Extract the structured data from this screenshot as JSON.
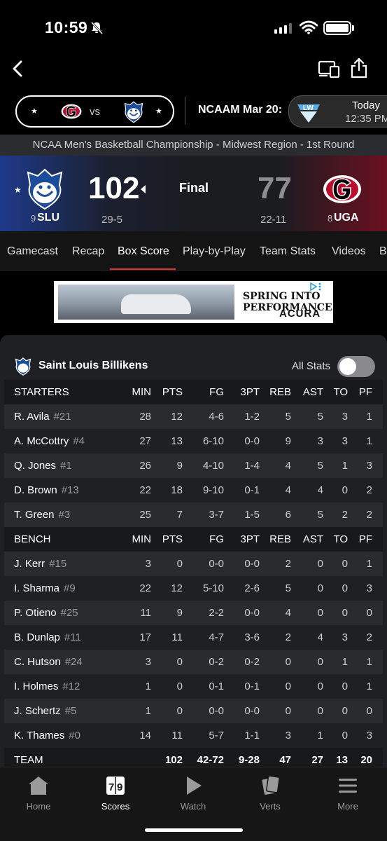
{
  "status_bar": {
    "time": "10:59"
  },
  "matchup": {
    "vs_label": "vs",
    "next_game_label": "NCAAM Mar 20:",
    "next_game_day": "Today",
    "next_game_time": "12:35 PM"
  },
  "tournament_label": "NCAA Men's Basketball Championship - Midwest Region - 1st Round",
  "score": {
    "home": {
      "seed": "9",
      "abbr": "SLU",
      "score": "102",
      "record": "29-5"
    },
    "away": {
      "seed": "8",
      "abbr": "UGA",
      "score": "77",
      "record": "22-11"
    },
    "status": "Final"
  },
  "tabs": [
    "Gamecast",
    "Recap",
    "Box Score",
    "Play-by-Play",
    "Team Stats",
    "Videos",
    "B"
  ],
  "active_tab": "Box Score",
  "ad": {
    "headline": "SPRING INTO PERFORMANCE.",
    "brand": "ACURA"
  },
  "box": {
    "team_name": "Saint Louis Billikens",
    "all_stats_label": "All Stats",
    "columns": [
      "MIN",
      "PTS",
      "FG",
      "3PT",
      "REB",
      "AST",
      "TO",
      "PF"
    ],
    "starters_label": "STARTERS",
    "bench_label": "BENCH",
    "team_label": "TEAM",
    "starters": [
      {
        "name": "R. Avila",
        "num": "#21",
        "stats": [
          "28",
          "12",
          "4-6",
          "1-2",
          "5",
          "5",
          "3",
          "1"
        ]
      },
      {
        "name": "A. McCottry",
        "num": "#4",
        "stats": [
          "27",
          "13",
          "6-10",
          "0-0",
          "9",
          "3",
          "3",
          "1"
        ]
      },
      {
        "name": "Q. Jones",
        "num": "#1",
        "stats": [
          "26",
          "9",
          "4-10",
          "1-4",
          "4",
          "5",
          "1",
          "3"
        ]
      },
      {
        "name": "D. Brown",
        "num": "#13",
        "stats": [
          "22",
          "18",
          "9-10",
          "0-1",
          "4",
          "4",
          "0",
          "2"
        ]
      },
      {
        "name": "T. Green",
        "num": "#3",
        "stats": [
          "25",
          "7",
          "3-7",
          "1-5",
          "6",
          "5",
          "2",
          "2"
        ]
      }
    ],
    "bench": [
      {
        "name": "J. Kerr",
        "num": "#15",
        "stats": [
          "3",
          "0",
          "0-0",
          "0-0",
          "2",
          "0",
          "0",
          "1"
        ]
      },
      {
        "name": "I. Sharma",
        "num": "#9",
        "stats": [
          "22",
          "12",
          "5-10",
          "2-6",
          "5",
          "0",
          "0",
          "3"
        ]
      },
      {
        "name": "P. Otieno",
        "num": "#25",
        "stats": [
          "11",
          "9",
          "2-2",
          "0-0",
          "4",
          "0",
          "0",
          "0"
        ]
      },
      {
        "name": "B. Dunlap",
        "num": "#11",
        "stats": [
          "17",
          "11",
          "4-7",
          "3-6",
          "2",
          "4",
          "3",
          "2"
        ]
      },
      {
        "name": "C. Hutson",
        "num": "#24",
        "stats": [
          "3",
          "0",
          "0-2",
          "0-2",
          "0",
          "0",
          "1",
          "1"
        ]
      },
      {
        "name": "I. Holmes",
        "num": "#12",
        "stats": [
          "1",
          "0",
          "0-1",
          "0-1",
          "0",
          "0",
          "0",
          "1"
        ]
      },
      {
        "name": "J. Schertz",
        "num": "#5",
        "stats": [
          "1",
          "0",
          "0-0",
          "0-0",
          "0",
          "0",
          "0",
          "0"
        ]
      },
      {
        "name": "K. Thames",
        "num": "#0",
        "stats": [
          "14",
          "11",
          "5-7",
          "1-1",
          "3",
          "1",
          "0",
          "3"
        ]
      }
    ],
    "team_totals": [
      "",
      "102",
      "42-72",
      "9-28",
      "47",
      "27",
      "13",
      "20"
    ]
  },
  "bottom_nav": [
    {
      "label": "Home",
      "icon": "home-icon"
    },
    {
      "label": "Scores",
      "icon": "scores-icon"
    },
    {
      "label": "Watch",
      "icon": "play-icon"
    },
    {
      "label": "Verts",
      "icon": "verts-icon"
    },
    {
      "label": "More",
      "icon": "menu-icon"
    }
  ],
  "active_nav": "Scores"
}
